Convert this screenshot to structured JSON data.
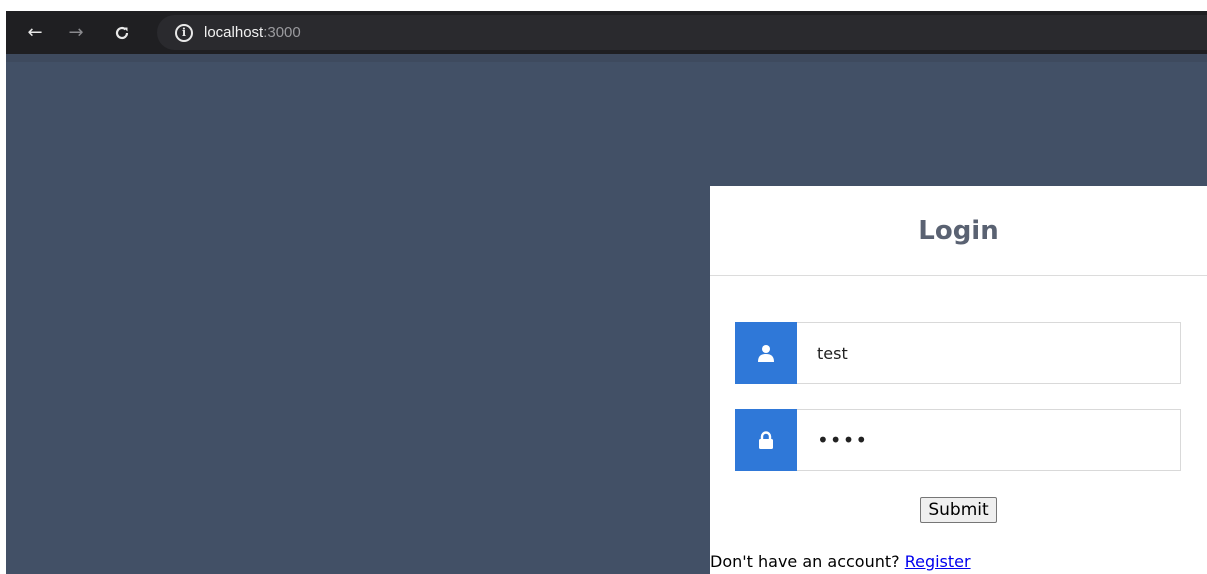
{
  "browser": {
    "url_host": "localhost",
    "url_port": ":3000"
  },
  "login": {
    "title": "Login",
    "username_value": "test",
    "password_value": "test",
    "submit_label": "Submit",
    "register_prompt": "Don't have an account? ",
    "register_link": "Register"
  },
  "icons": {
    "back": "arrow-left-icon",
    "forward": "arrow-right-icon",
    "reload": "reload-icon",
    "info": "info-icon",
    "user": "user-icon",
    "lock": "lock-icon"
  },
  "colors": {
    "background": "#425066",
    "accent": "#2f78d8",
    "title": "#5a6272",
    "browser_bar": "#1f1f22"
  }
}
